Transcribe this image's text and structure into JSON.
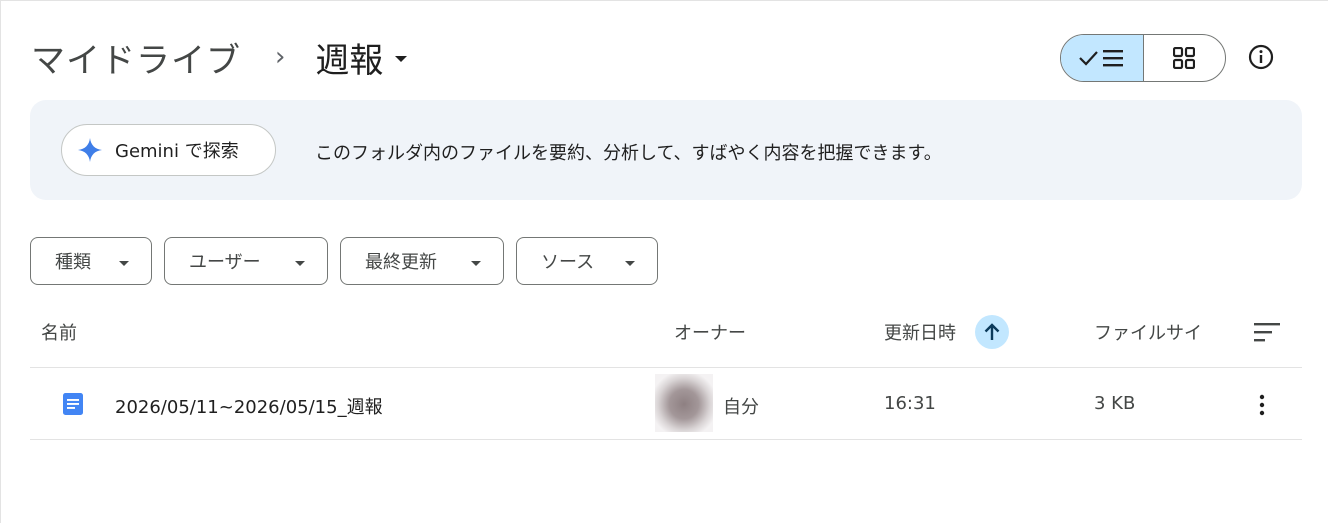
{
  "breadcrumb": {
    "root": "マイドライブ",
    "separator": "›",
    "current": "週報"
  },
  "view_toggle": {
    "list_icon": "check-list-icon",
    "grid_icon": "grid-icon"
  },
  "info_icon": "info-icon",
  "banner": {
    "button_label": "Gemini で探索",
    "button_icon": "gemini-sparkle-icon",
    "text": "このフォルダ内のファイルを要約、分析して、すばやく内容を把握できます。"
  },
  "filters": [
    {
      "label": "種類"
    },
    {
      "label": "ユーザー"
    },
    {
      "label": "最終更新"
    },
    {
      "label": "ソース"
    }
  ],
  "table": {
    "headers": {
      "name": "名前",
      "owner": "オーナー",
      "modified": "更新日時",
      "size": "ファイルサイ"
    },
    "sort": {
      "column": "modified",
      "direction": "ascending",
      "icon": "arrow-up-icon"
    },
    "rows": [
      {
        "icon": "google-docs-icon",
        "name": "2026/05/11~2026/05/15_週報",
        "owner": "自分",
        "modified": "16:31",
        "size": "3 KB"
      }
    ]
  },
  "colors": {
    "accent_bg": "#c2e7ff",
    "banner_bg": "#f0f4f9",
    "docs_blue": "#4285f4",
    "gemini_blue": "#3f7ee8"
  }
}
